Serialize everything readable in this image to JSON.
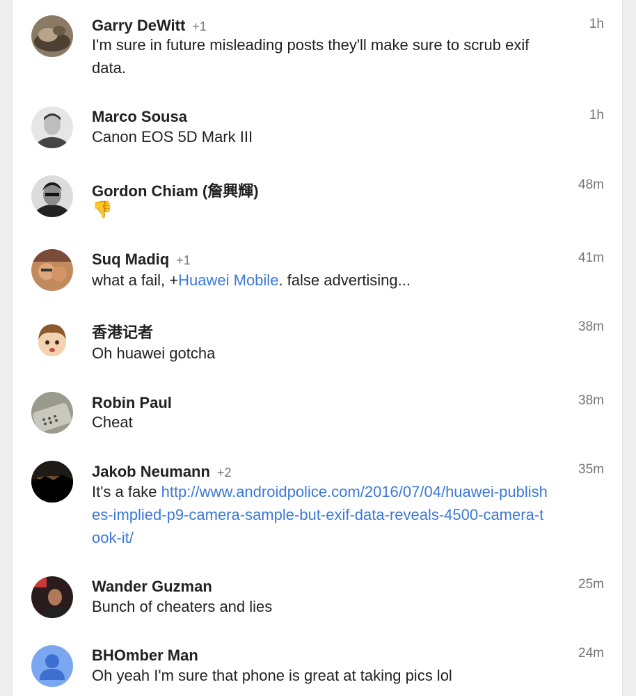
{
  "comments": [
    {
      "name": "Garry DeWitt",
      "plus": "+1",
      "time": "1h",
      "text": "I'm sure in future misleading posts they'll make sure to scrub exif data."
    },
    {
      "name": "Marco Sousa",
      "plus": "",
      "time": "1h",
      "text": "Canon EOS 5D Mark III"
    },
    {
      "name": "Gordon Chiam (詹興輝)",
      "plus": "",
      "time": "48m",
      "text": "👎"
    },
    {
      "name": "Suq Madiq",
      "plus": "+1",
      "time": "41m",
      "text_before": "what a fail, +",
      "mention": "Huawei Mobile",
      "text_after": ". false advertising..."
    },
    {
      "name": "香港记者",
      "plus": "",
      "time": "38m",
      "text": "Oh huawei gotcha"
    },
    {
      "name": "Robin Paul",
      "plus": "",
      "time": "38m",
      "text": "Cheat"
    },
    {
      "name": "Jakob Neumann",
      "plus": "+2",
      "time": "35m",
      "text_before": "It's a fake ",
      "link": "http://www.androidpolice.com/2016/07/04/huawei-publishes-implied-p9-camera-sample-but-exif-data-reveals-4500-camera-took-it/"
    },
    {
      "name": "Wander Guzman",
      "plus": "",
      "time": "25m",
      "text": "Bunch of cheaters and lies"
    },
    {
      "name": "BHOmber Man",
      "plus": "",
      "time": "24m",
      "text": "Oh yeah I'm sure that phone is great at taking pics lol"
    }
  ],
  "colors": {
    "link": "#3b78d8",
    "text": "#212121",
    "meta": "#757575",
    "default_avatar": "#7aa7f0"
  }
}
